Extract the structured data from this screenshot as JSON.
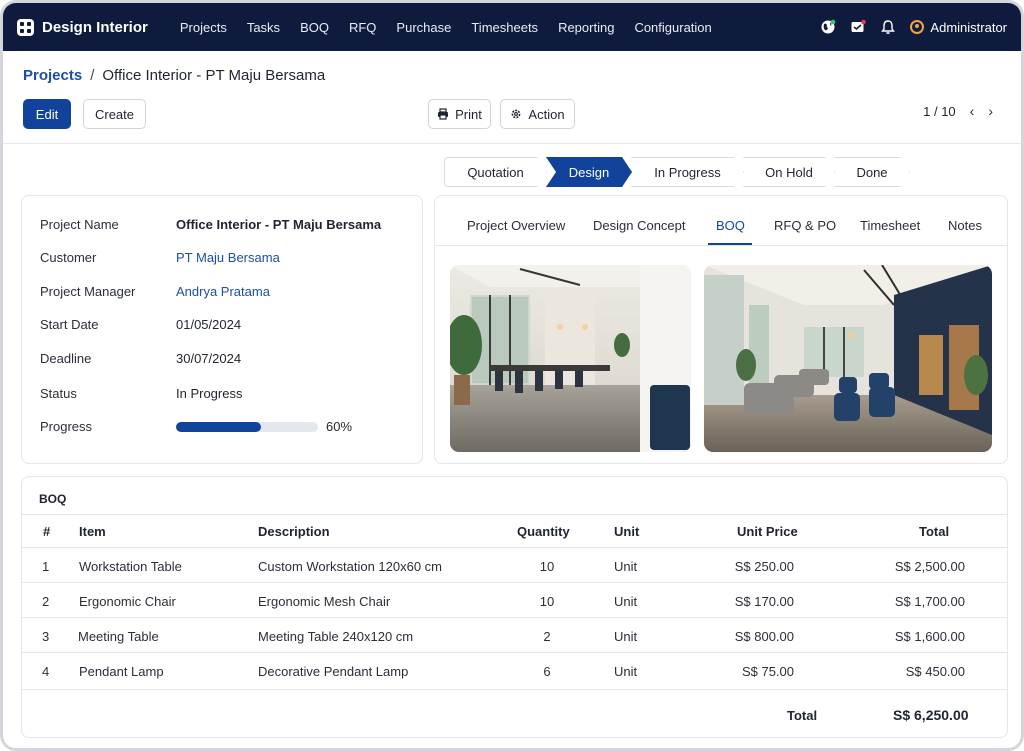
{
  "app": {
    "title": "Design Interior"
  },
  "nav": {
    "items": [
      "Projects",
      "Tasks",
      "BOQ",
      "RFQ",
      "Purchase",
      "Timesheets",
      "Reporting",
      "Configuration"
    ],
    "user": "Administrator"
  },
  "breadcrumb": {
    "parent": "Projects",
    "separator": "/",
    "current": "Office Interior - PT Maju Bersama"
  },
  "toolbar": {
    "edit": "Edit",
    "create": "Create",
    "print": "Print",
    "action": "Action",
    "pager": "1 / 10"
  },
  "stages": [
    "Quotation",
    "Design",
    "In Progress",
    "On Hold",
    "Done"
  ],
  "active_stage": "Design",
  "project": {
    "labels": {
      "name": "Project Name",
      "customer": "Customer",
      "manager": "Project Manager",
      "start": "Start Date",
      "deadline": "Deadline",
      "status": "Status",
      "progress": "Progress"
    },
    "name": "Office Interior - PT Maju Bersama",
    "customer": "PT Maju Bersama",
    "manager": "Andrya Pratama",
    "start": "01/05/2024",
    "deadline": "30/07/2024",
    "status": "In Progress",
    "progress_pct": 60,
    "progress_text": "60%"
  },
  "tabs": [
    "Project Overview",
    "Design Concept",
    "BOQ",
    "RFQ & PO",
    "Timesheet",
    "Notes"
  ],
  "active_tab": "BOQ",
  "boq": {
    "title": "BOQ",
    "headers": {
      "no": "#",
      "item": "Item",
      "description": "Description",
      "quantity": "Quantity",
      "unit": "Unit",
      "unit_price": "Unit Price",
      "total": "Total"
    },
    "rows": [
      {
        "no": "1",
        "item": "Workstation Table",
        "description": "Custom Workstation 120x60 cm",
        "quantity": "10",
        "unit": "Unit",
        "unit_price": "S$ 250.00",
        "total": "S$ 2,500.00"
      },
      {
        "no": "2",
        "item": "Ergonomic Chair",
        "description": "Ergonomic Mesh Chair",
        "quantity": "10",
        "unit": "Unit",
        "unit_price": "S$ 170.00",
        "total": "S$ 1,700.00"
      },
      {
        "no": "3",
        "item": "Meeting Table",
        "description": "Meeting Table 240x120 cm",
        "quantity": "2",
        "unit": "Unit",
        "unit_price": "S$ 800.00",
        "total": "S$ 1,600.00"
      },
      {
        "no": "4",
        "item": "Pendant Lamp",
        "description": "Decorative Pendant Lamp",
        "quantity": "6",
        "unit": "Unit",
        "unit_price": "S$ 75.00",
        "total": "S$ 450.00"
      }
    ],
    "total_label": "Total",
    "total_value": "S$ 6,250.00"
  },
  "icons": [
    "grid-logo-icon",
    "globe-icon",
    "chat-icon",
    "bell-icon",
    "user-avatar-icon",
    "printer-icon",
    "gear-icon",
    "chevron-left-icon",
    "chevron-right-icon"
  ],
  "colors": {
    "navbar": "#0f1b3d",
    "primary": "#12439c",
    "link": "#1d4ea8"
  }
}
